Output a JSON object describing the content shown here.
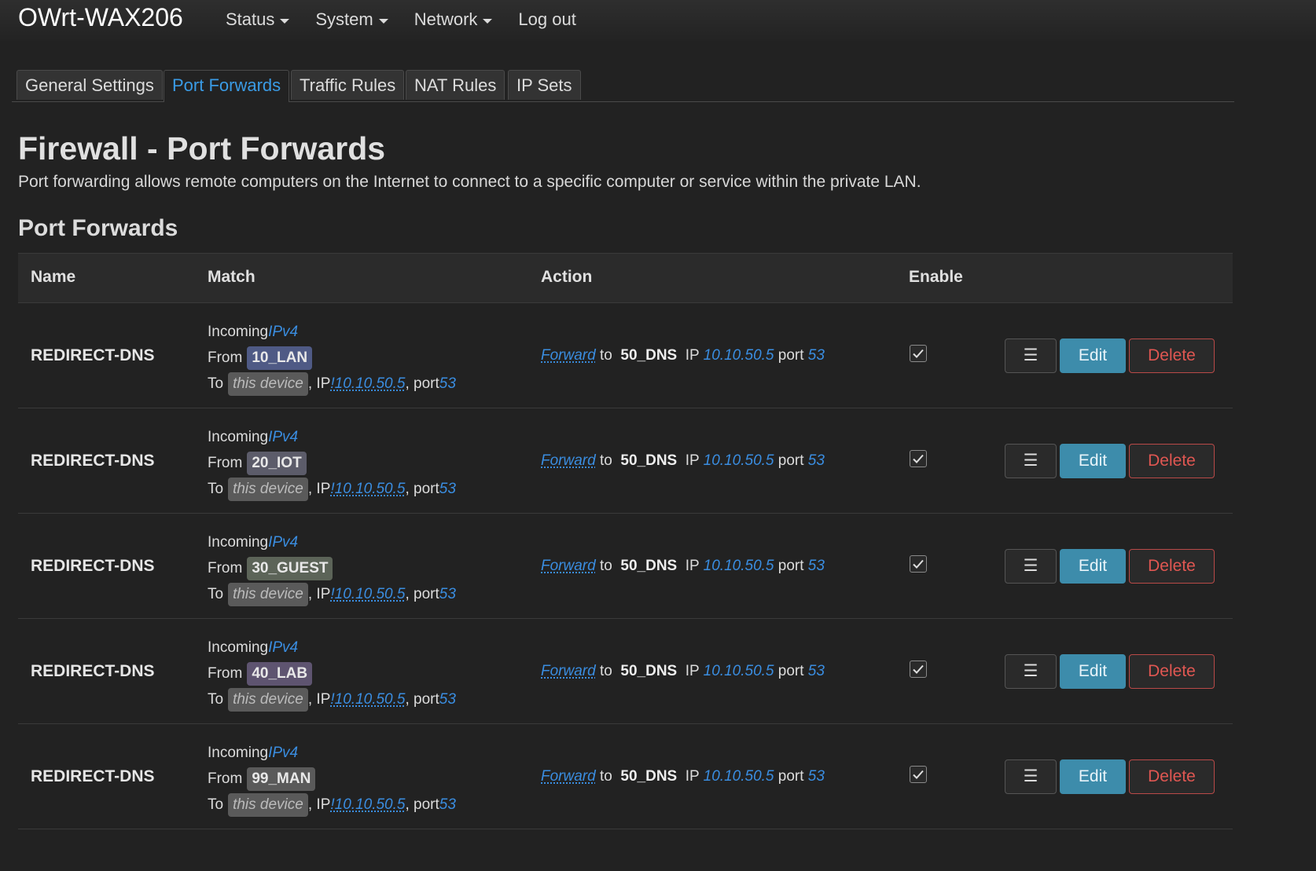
{
  "header": {
    "brand": "OWrt-WAX206",
    "menu": [
      {
        "label": "Status",
        "dropdown": true
      },
      {
        "label": "System",
        "dropdown": true
      },
      {
        "label": "Network",
        "dropdown": true
      },
      {
        "label": "Log out",
        "dropdown": false
      }
    ]
  },
  "tabs": [
    {
      "label": "General Settings",
      "active": false
    },
    {
      "label": "Port Forwards",
      "active": true
    },
    {
      "label": "Traffic Rules",
      "active": false
    },
    {
      "label": "NAT Rules",
      "active": false
    },
    {
      "label": "IP Sets",
      "active": false
    }
  ],
  "page": {
    "title": "Firewall - Port Forwards",
    "description": "Port forwarding allows remote computers on the Internet to connect to a specific computer or service within the private LAN.",
    "section_title": "Port Forwards"
  },
  "table": {
    "headers": {
      "name": "Name",
      "match": "Match",
      "action": "Action",
      "enable": "Enable"
    },
    "rows": [
      {
        "name": "REDIRECT-DNS",
        "incoming": "Incoming",
        "family": "IPv4",
        "from": "From",
        "zone": "10_LAN",
        "zone_color": "#4f5a85",
        "to": "To",
        "device": "this device",
        "ip_label": ", IP",
        "ip": "!10.10.50.5",
        "port_label": ", port",
        "port": "53",
        "action": "Forward",
        "to_word": "to",
        "dest_zone": "50_DNS",
        "dest_ip_label": "IP",
        "dest_ip": "10.10.50.5",
        "dest_port_label": "port",
        "dest_port": "53",
        "enabled": true,
        "menu_btn": "☰",
        "edit": "Edit",
        "delete": "Delete"
      },
      {
        "name": "REDIRECT-DNS",
        "incoming": "Incoming",
        "family": "IPv4",
        "from": "From",
        "zone": "20_IOT",
        "zone_color": "#5c5c6a",
        "to": "To",
        "device": "this device",
        "ip_label": ", IP",
        "ip": "!10.10.50.5",
        "port_label": ", port",
        "port": "53",
        "action": "Forward",
        "to_word": "to",
        "dest_zone": "50_DNS",
        "dest_ip_label": "IP",
        "dest_ip": "10.10.50.5",
        "dest_port_label": "port",
        "dest_port": "53",
        "enabled": true,
        "menu_btn": "☰",
        "edit": "Edit",
        "delete": "Delete"
      },
      {
        "name": "REDIRECT-DNS",
        "incoming": "Incoming",
        "family": "IPv4",
        "from": "From",
        "zone": "30_GUEST",
        "zone_color": "#5c6458",
        "to": "To",
        "device": "this device",
        "ip_label": ", IP",
        "ip": "!10.10.50.5",
        "port_label": ", port",
        "port": "53",
        "action": "Forward",
        "to_word": "to",
        "dest_zone": "50_DNS",
        "dest_ip_label": "IP",
        "dest_ip": "10.10.50.5",
        "dest_port_label": "port",
        "dest_port": "53",
        "enabled": true,
        "menu_btn": "☰",
        "edit": "Edit",
        "delete": "Delete"
      },
      {
        "name": "REDIRECT-DNS",
        "incoming": "Incoming",
        "family": "IPv4",
        "from": "From",
        "zone": "40_LAB",
        "zone_color": "#5e5470",
        "to": "To",
        "device": "this device",
        "ip_label": ", IP",
        "ip": "!10.10.50.5",
        "port_label": ", port",
        "port": "53",
        "action": "Forward",
        "to_word": "to",
        "dest_zone": "50_DNS",
        "dest_ip_label": "IP",
        "dest_ip": "10.10.50.5",
        "dest_port_label": "port",
        "dest_port": "53",
        "enabled": true,
        "menu_btn": "☰",
        "edit": "Edit",
        "delete": "Delete"
      },
      {
        "name": "REDIRECT-DNS",
        "incoming": "Incoming",
        "family": "IPv4",
        "from": "From",
        "zone": "99_MAN",
        "zone_color": "#5a5a5a",
        "to": "To",
        "device": "this device",
        "ip_label": ", IP",
        "ip": "!10.10.50.5",
        "port_label": ", port",
        "port": "53",
        "action": "Forward",
        "to_word": "to",
        "dest_zone": "50_DNS",
        "dest_ip_label": "IP",
        "dest_ip": "10.10.50.5",
        "dest_port_label": "port",
        "dest_port": "53",
        "enabled": true,
        "menu_btn": "☰",
        "edit": "Edit",
        "delete": "Delete"
      }
    ]
  },
  "colors": {
    "background": "#222222",
    "link": "#3a8de0",
    "accent": "#3a9be5",
    "edit_button": "#3d8cab",
    "delete_button": "#e05752"
  }
}
